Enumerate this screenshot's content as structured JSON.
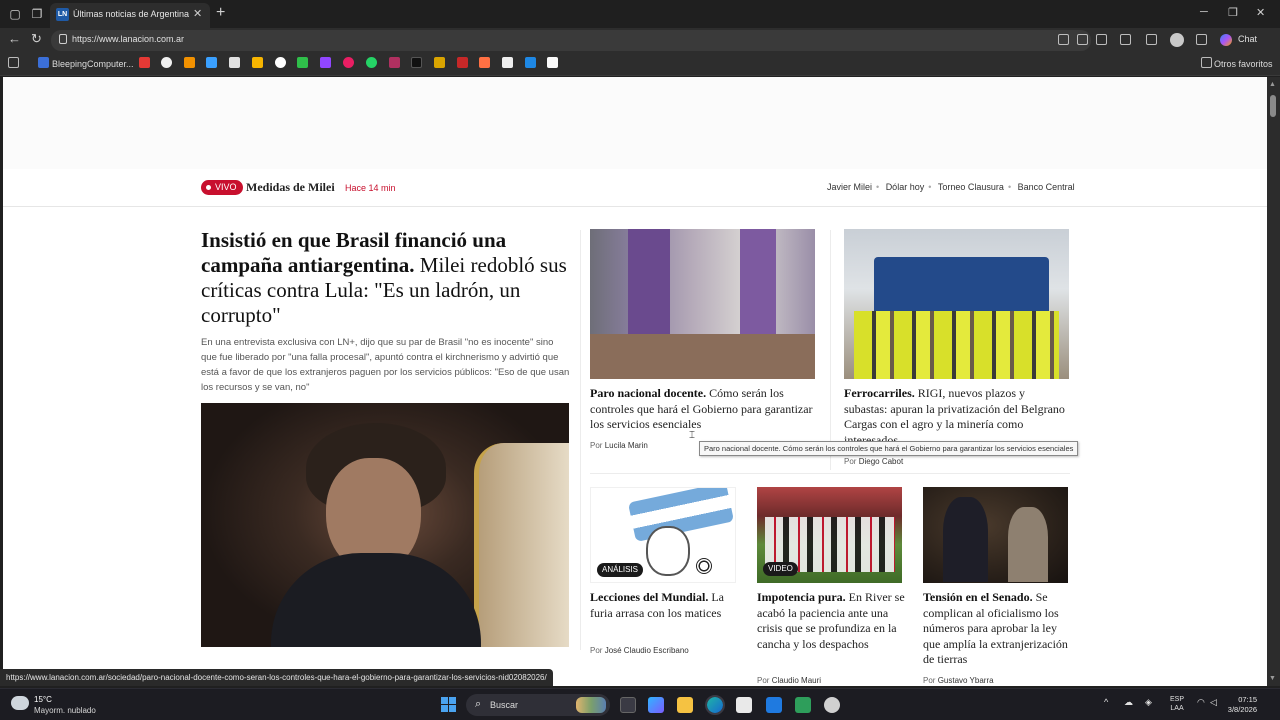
{
  "browser": {
    "tab_title": "Últimas noticias de Argentina y el",
    "tab_favicon_text": "LN",
    "url": "https://www.lanacion.com.ar",
    "bookmarks": {
      "first_label": "BleepingComputer...",
      "other_favorites": "Otros favoritos"
    },
    "chat_label": "Chat"
  },
  "page": {
    "live": {
      "badge": "VIVO",
      "title": "Medidas de Milei",
      "time": "Hace 14 min"
    },
    "topics": [
      "Javier Milei",
      "Dólar hoy",
      "Torneo Clausura",
      "Banco Central"
    ],
    "main_story": {
      "headline_bold": "Insistió en que Brasil financió una campaña antiargentina.",
      "headline_rest": " Milei redobló sus críticas contra Lula: \"Es un ladrón, un corrupto\"",
      "lead": "En una entrevista exclusiva con LN+, dijo que su par de Brasil \"no es inocente\" sino que fue liberado por \"una falla procesal\", apuntó contra el kirchnerismo y advirtió que está a favor de que los extranjeros paguen por los servicios públicos: \"Eso de que usan los recursos y se van, no\""
    },
    "cards": [
      {
        "kicker": "Paro nacional docente.",
        "text": " Cómo serán los controles que hará el Gobierno para garantizar los servicios esenciales",
        "byline_prefix": "Por",
        "author": "Lucila Marin"
      },
      {
        "kicker": "Ferrocarriles.",
        "text": " RIGI, nuevos plazos y subastas: apuran la privatización del Belgrano Cargas con el agro y la minería como interesados",
        "byline_prefix": "Por",
        "author": "Diego Cabot"
      },
      {
        "badge": "ANÁLISIS",
        "kicker": "Lecciones del Mundial.",
        "text": " La furia arrasa con los matices",
        "byline_prefix": "Por",
        "author": "José Claudio Escribano"
      },
      {
        "badge": "VIDEO",
        "kicker": "Impotencia pura.",
        "text": " En River se acabó la paciencia ante una crisis que se profundiza en la cancha y los despachos",
        "byline_prefix": "Por",
        "author": "Claudio Mauri"
      },
      {
        "kicker": "Tensión en el Senado.",
        "text": " Se complican al oficialismo los números para aprobar la ley que amplía la extranjerización de tierras",
        "byline_prefix": "Por",
        "author": "Gustavo Ybarra"
      }
    ],
    "tooltip": "Paro nacional docente. Cómo serán los controles que hará el Gobierno para garantizar los servicios esenciales",
    "status_link": "https://www.lanacion.com.ar/sociedad/paro-nacional-docente-como-seran-los-controles-que-hara-el-gobierno-para-garantizar-los-servicios-nid02082026/"
  },
  "taskbar": {
    "weather_temp": "15°C",
    "weather_desc": "Mayorm. nublado",
    "search_label": "Buscar",
    "lang_top": "ESP",
    "lang_bottom": "LAA",
    "time": "07:15",
    "date": "3/8/2026"
  },
  "colors": {
    "accent_red": "#c8102e",
    "browser_dark": "#202020"
  }
}
